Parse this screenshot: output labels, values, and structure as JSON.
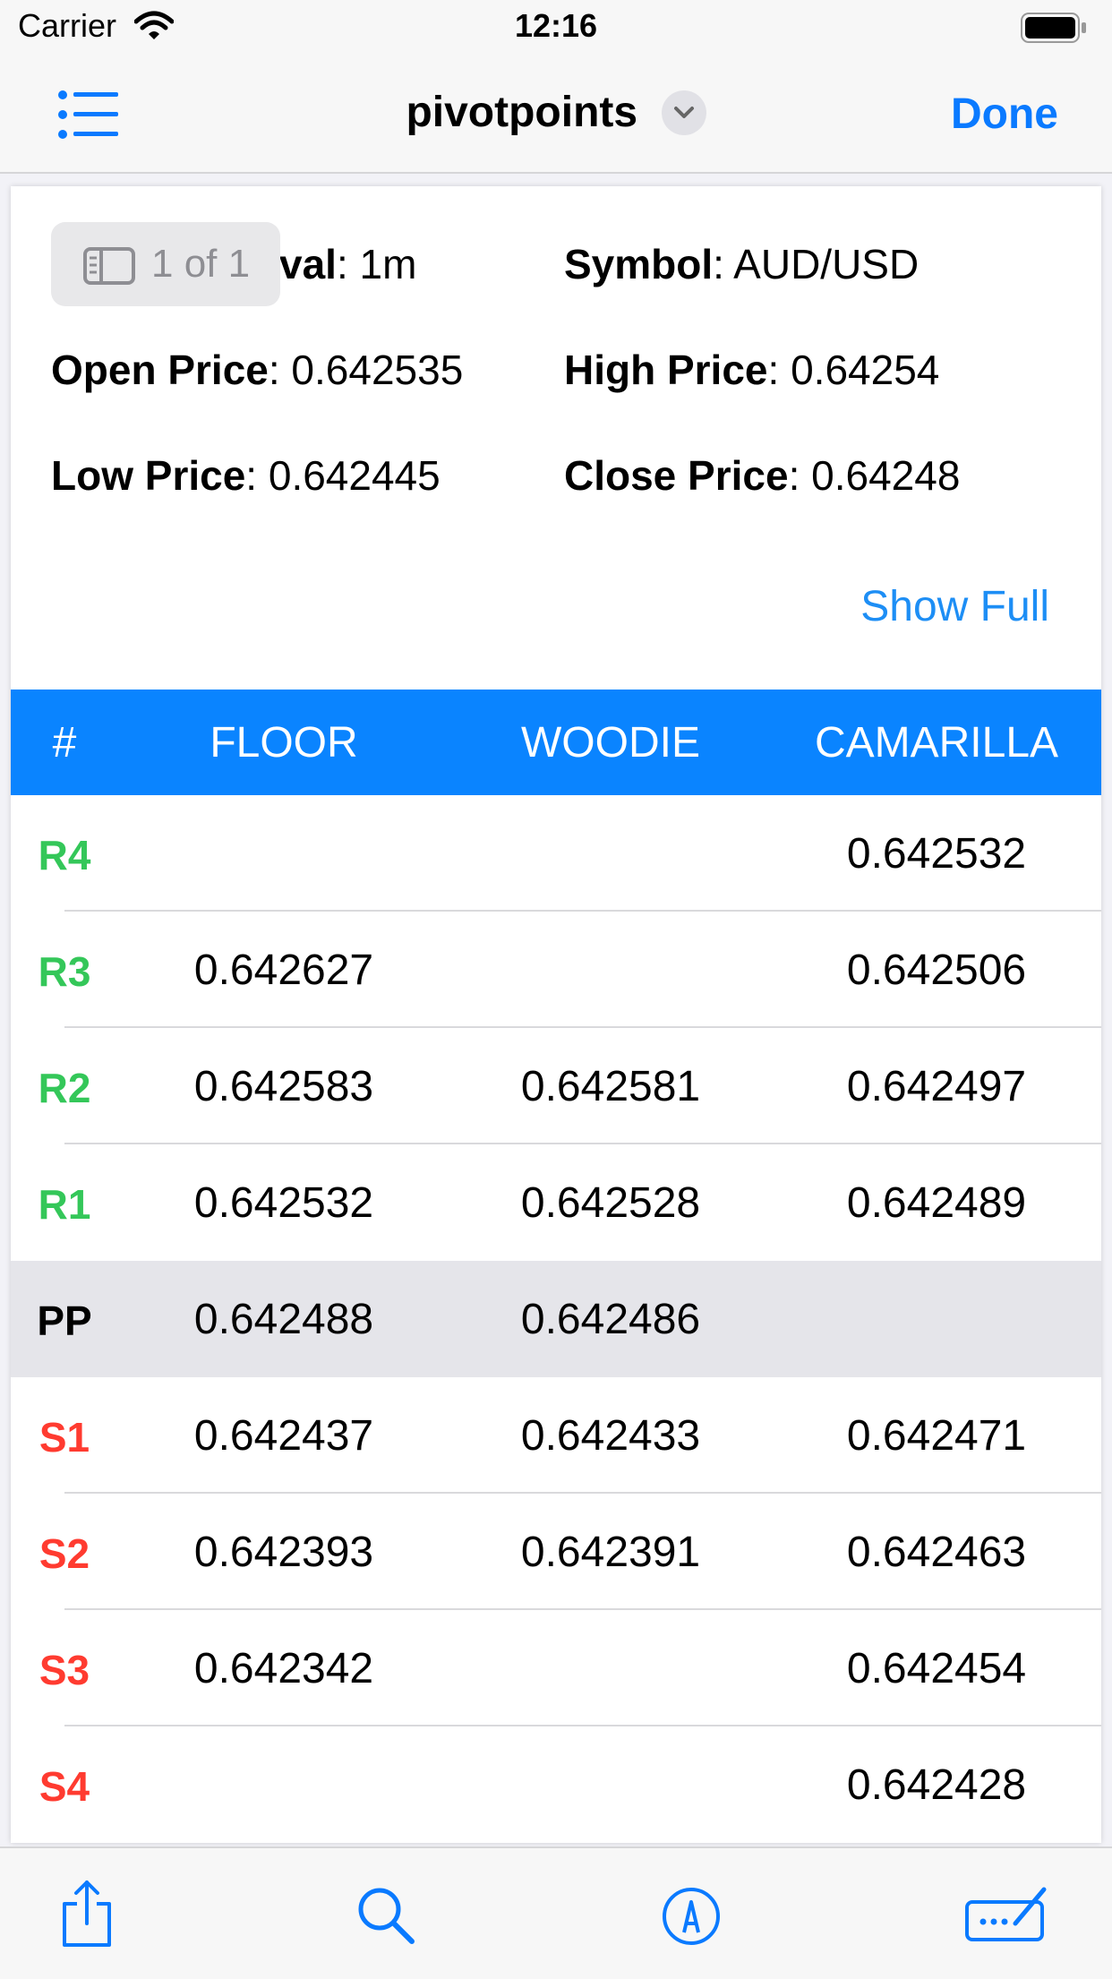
{
  "status_bar": {
    "carrier": "Carrier",
    "time": "12:16"
  },
  "nav": {
    "title": "pivotpoints",
    "done_label": "Done"
  },
  "page_badge": {
    "text": "1 of 1"
  },
  "info": {
    "interval_label": "val",
    "interval_value": ": 1m",
    "symbol_label": "Symbol",
    "symbol_value": ": AUD/USD",
    "open_label": "Open Price",
    "open_value": ": 0.642535",
    "high_label": "High Price",
    "high_value": ": 0.64254",
    "low_label": "Low Price",
    "low_value": ": 0.642445",
    "close_label": "Close Price",
    "close_value": ": 0.64248"
  },
  "show_full_label": "Show Full",
  "table": {
    "headers": [
      "#",
      "FLOOR",
      "WOODIE",
      "CAMARILLA"
    ],
    "rows": [
      {
        "label": "R4",
        "floor": "",
        "woodie": "",
        "camarilla": "0.642532"
      },
      {
        "label": "R3",
        "floor": "0.642627",
        "woodie": "",
        "camarilla": "0.642506"
      },
      {
        "label": "R2",
        "floor": "0.642583",
        "woodie": "0.642581",
        "camarilla": "0.642497"
      },
      {
        "label": "R1",
        "floor": "0.642532",
        "woodie": "0.642528",
        "camarilla": "0.642489"
      },
      {
        "label": "PP",
        "floor": "0.642488",
        "woodie": "0.642486",
        "camarilla": ""
      },
      {
        "label": "S1",
        "floor": "0.642437",
        "woodie": "0.642433",
        "camarilla": "0.642471"
      },
      {
        "label": "S2",
        "floor": "0.642393",
        "woodie": "0.642391",
        "camarilla": "0.642463"
      },
      {
        "label": "S3",
        "floor": "0.642342",
        "woodie": "",
        "camarilla": "0.642454"
      },
      {
        "label": "S4",
        "floor": "",
        "woodie": "",
        "camarilla": "0.642428"
      }
    ]
  },
  "colors": {
    "accent": "#0a84ff",
    "resistance": "#34c759",
    "support": "#ff3b30",
    "pivot_bg": "#e5e5ea"
  },
  "toolbar": {
    "icons": [
      "share-icon",
      "search-icon",
      "markup-icon",
      "annotate-icon"
    ]
  }
}
